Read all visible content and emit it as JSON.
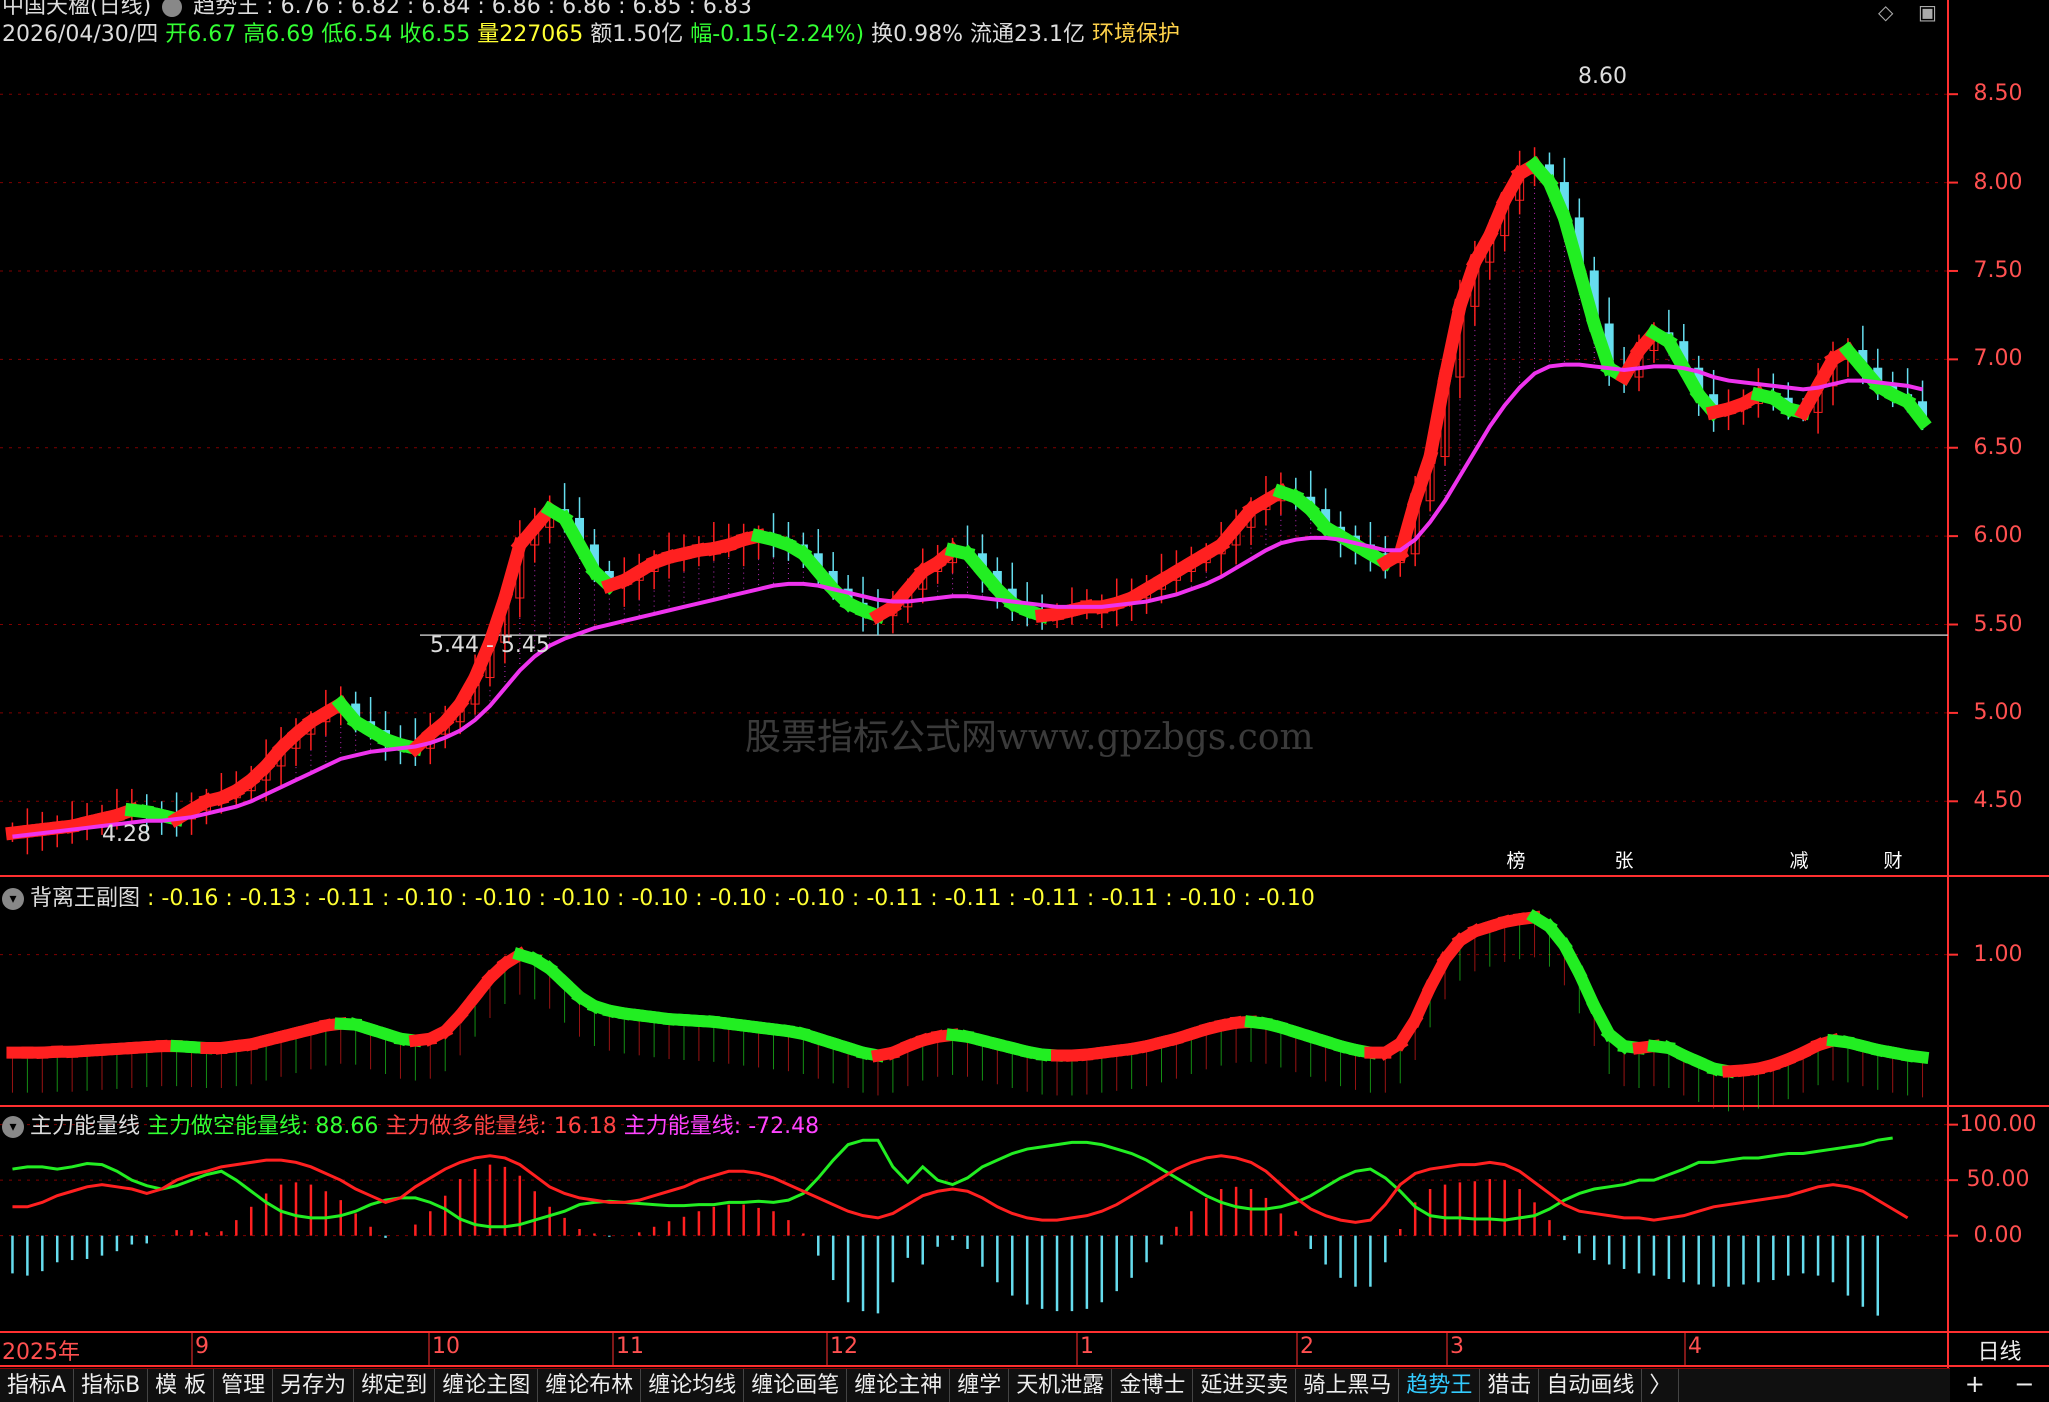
{
  "header": {
    "stock_title": "中国天楹(日线)",
    "indicator_row": "趋势王 : 6.76 : 6.82 : 6.84 : 6.86 : 6.86 : 6.85 : 6.83",
    "date": "2026/04/30/四",
    "open": "开6.67",
    "high": "高6.69",
    "low": "低6.54",
    "close": "收6.55",
    "volume": "量227065",
    "amount": "额1.50亿",
    "change": "幅-0.15(-2.24%)",
    "turnover": "换0.98%",
    "float_cap": "流通23.1亿",
    "tag": "环境保护"
  },
  "price_labels": {
    "high_mark": "8.60",
    "low_mark": "4.28",
    "range_mark": "5.44 - 5.45"
  },
  "panel2": {
    "title": "背离王副图",
    "values": ": -0.16 : -0.13 : -0.11 : -0.10 : -0.10 : -0.10 : -0.10 : -0.10 : -0.10 : -0.11 : -0.11 : -0.11 : -0.11 : -0.10 : -0.10"
  },
  "panel3": {
    "title": "主力能量线",
    "short_line": "主力做空能量线: 88.66",
    "long_line": "主力做多能量线: 16.18",
    "main_line": "主力能量线: -72.48"
  },
  "badges": [
    {
      "text": "榜",
      "color": "#b5651d"
    },
    {
      "text": "张",
      "color": "#b22222"
    },
    {
      "text": "减",
      "color": "#2e8b57"
    },
    {
      "text": "财",
      "color": "#1e4fb0"
    }
  ],
  "watermark": "股票指标公式网www.gpzbgs.com",
  "period_label": "日线",
  "tabs": [
    "指标A",
    "指标B",
    "模 板",
    "管理",
    "另存为",
    "绑定到",
    "缠论主图",
    "缠论布林",
    "缠论均线",
    "缠论画笔",
    "缠论主神",
    "缠学",
    "天机泄露",
    "金博士",
    "延进买卖",
    "骑上黑马",
    "趋势王",
    "猎击",
    "自动画线",
    "〉"
  ],
  "active_tab": "趋势王",
  "right_tools": [
    "+",
    "−"
  ],
  "colors": {
    "up": "#ff2020",
    "down": "#22ee22",
    "ma": "#ee33ee",
    "axis": "#ff3030",
    "grid": "#800000",
    "cyan": "#66ddee"
  },
  "chart_data": [
    {
      "type": "candlestick",
      "title": "中国天楹(日线)",
      "y_ticks": [
        4.5,
        5.0,
        5.5,
        6.0,
        6.5,
        7.0,
        7.5,
        8.0,
        8.5
      ],
      "ylim": [
        4.1,
        8.75
      ],
      "x_ticks": [
        "2025年",
        "9",
        "10",
        "11",
        "12",
        "1",
        "2",
        "3",
        "4"
      ],
      "close": [
        4.32,
        4.33,
        4.34,
        4.35,
        4.36,
        4.38,
        4.4,
        4.42,
        4.45,
        4.44,
        4.42,
        4.4,
        4.45,
        4.5,
        4.52,
        4.56,
        4.62,
        4.7,
        4.8,
        4.88,
        4.95,
        5.0,
        5.05,
        4.95,
        4.9,
        4.85,
        4.82,
        4.8,
        4.88,
        4.95,
        5.05,
        5.2,
        5.4,
        5.65,
        5.95,
        6.05,
        6.15,
        6.1,
        5.95,
        5.8,
        5.72,
        5.75,
        5.8,
        5.85,
        5.88,
        5.9,
        5.92,
        5.93,
        5.95,
        5.98,
        6.0,
        5.98,
        5.95,
        5.9,
        5.8,
        5.7,
        5.62,
        5.58,
        5.55,
        5.6,
        5.7,
        5.8,
        5.85,
        5.92,
        5.9,
        5.8,
        5.7,
        5.62,
        5.58,
        5.55,
        5.56,
        5.58,
        5.6,
        5.6,
        5.62,
        5.65,
        5.7,
        5.75,
        5.8,
        5.85,
        5.9,
        5.95,
        6.05,
        6.15,
        6.2,
        6.25,
        6.22,
        6.15,
        6.05,
        6.0,
        5.95,
        5.9,
        5.85,
        5.9,
        6.2,
        6.45,
        6.9,
        7.3,
        7.55,
        7.7,
        7.9,
        8.05,
        8.1,
        8.0,
        7.8,
        7.5,
        7.2,
        6.95,
        6.9,
        7.05,
        7.15,
        7.1,
        6.95,
        6.8,
        6.7,
        6.72,
        6.75,
        6.8,
        6.78,
        6.72,
        6.7,
        6.85,
        7.0,
        7.05,
        6.95,
        6.85,
        6.8,
        6.76,
        6.65
      ],
      "ma": [
        4.3,
        4.31,
        4.32,
        4.33,
        4.34,
        4.35,
        4.36,
        4.37,
        4.38,
        4.39,
        4.39,
        4.4,
        4.41,
        4.43,
        4.45,
        4.47,
        4.5,
        4.54,
        4.58,
        4.62,
        4.66,
        4.7,
        4.74,
        4.76,
        4.78,
        4.79,
        4.8,
        4.81,
        4.83,
        4.86,
        4.9,
        4.96,
        5.04,
        5.14,
        5.24,
        5.32,
        5.38,
        5.42,
        5.45,
        5.48,
        5.5,
        5.52,
        5.54,
        5.56,
        5.58,
        5.6,
        5.62,
        5.64,
        5.66,
        5.68,
        5.7,
        5.72,
        5.73,
        5.73,
        5.72,
        5.7,
        5.68,
        5.66,
        5.64,
        5.63,
        5.63,
        5.64,
        5.65,
        5.66,
        5.66,
        5.65,
        5.64,
        5.63,
        5.62,
        5.61,
        5.6,
        5.6,
        5.6,
        5.6,
        5.61,
        5.62,
        5.63,
        5.65,
        5.67,
        5.7,
        5.73,
        5.77,
        5.82,
        5.87,
        5.92,
        5.96,
        5.98,
        5.99,
        5.99,
        5.98,
        5.96,
        5.94,
        5.92,
        5.92,
        5.98,
        6.08,
        6.2,
        6.34,
        6.48,
        6.62,
        6.74,
        6.84,
        6.92,
        6.96,
        6.97,
        6.97,
        6.96,
        6.95,
        6.94,
        6.95,
        6.96,
        6.96,
        6.95,
        6.93,
        6.9,
        6.88,
        6.87,
        6.86,
        6.85,
        6.84,
        6.83,
        6.84,
        6.86,
        6.88,
        6.88,
        6.87,
        6.86,
        6.85,
        6.83
      ]
    },
    {
      "type": "line",
      "title": "背离王副图",
      "y_ticks": [
        1.0
      ],
      "ylim": [
        -0.6,
        1.8
      ],
      "values": [
        -0.05,
        -0.05,
        -0.05,
        -0.04,
        -0.04,
        -0.03,
        -0.02,
        -0.01,
        0.0,
        0.01,
        0.02,
        0.02,
        0.01,
        0.0,
        0.0,
        0.02,
        0.04,
        0.08,
        0.12,
        0.16,
        0.2,
        0.24,
        0.26,
        0.25,
        0.2,
        0.15,
        0.1,
        0.08,
        0.1,
        0.18,
        0.35,
        0.55,
        0.75,
        0.9,
        1.0,
        0.95,
        0.85,
        0.7,
        0.55,
        0.45,
        0.4,
        0.37,
        0.35,
        0.33,
        0.31,
        0.3,
        0.29,
        0.28,
        0.26,
        0.24,
        0.22,
        0.2,
        0.18,
        0.15,
        0.1,
        0.05,
        0.0,
        -0.05,
        -0.08,
        -0.05,
        0.02,
        0.08,
        0.12,
        0.14,
        0.12,
        0.08,
        0.04,
        0.0,
        -0.04,
        -0.07,
        -0.08,
        -0.08,
        -0.07,
        -0.05,
        -0.03,
        -0.01,
        0.02,
        0.06,
        0.1,
        0.15,
        0.2,
        0.24,
        0.27,
        0.28,
        0.26,
        0.22,
        0.17,
        0.12,
        0.07,
        0.02,
        -0.02,
        -0.05,
        -0.05,
        0.05,
        0.3,
        0.65,
        0.95,
        1.15,
        1.25,
        1.3,
        1.35,
        1.38,
        1.4,
        1.3,
        1.1,
        0.8,
        0.45,
        0.15,
        0.02,
        0.0,
        0.02,
        0.0,
        -0.08,
        -0.15,
        -0.22,
        -0.25,
        -0.24,
        -0.22,
        -0.18,
        -0.12,
        -0.05,
        0.03,
        0.08,
        0.06,
        0.02,
        -0.02,
        -0.05,
        -0.08,
        -0.1
      ]
    },
    {
      "type": "line",
      "title": "主力能量线",
      "y_ticks": [
        0.0,
        50.0,
        100.0
      ],
      "ylim": [
        -85,
        115
      ],
      "series": [
        {
          "name": "主力做空能量线",
          "color": "#22ee22",
          "values": [
            60,
            62,
            62,
            60,
            62,
            65,
            64,
            58,
            50,
            45,
            42,
            45,
            50,
            55,
            58,
            50,
            40,
            30,
            22,
            18,
            16,
            16,
            18,
            22,
            28,
            32,
            34,
            34,
            30,
            24,
            15,
            10,
            8,
            8,
            10,
            14,
            18,
            22,
            28,
            30,
            31,
            30,
            29,
            28,
            27,
            27,
            28,
            28,
            30,
            30,
            31,
            30,
            32,
            38,
            52,
            68,
            82,
            86,
            86,
            62,
            48,
            62,
            50,
            46,
            52,
            62,
            68,
            74,
            78,
            80,
            82,
            84,
            84,
            82,
            78,
            74,
            68,
            60,
            52,
            44,
            36,
            30,
            26,
            24,
            24,
            26,
            30,
            36,
            44,
            52,
            58,
            60,
            52,
            40,
            26,
            18,
            16,
            16,
            15,
            15,
            14,
            16,
            18,
            24,
            32,
            38,
            42,
            44,
            46,
            50,
            50,
            55,
            60,
            66,
            66,
            68,
            70,
            70,
            72,
            74,
            74,
            76,
            78,
            80,
            82,
            86,
            88
          ]
        },
        {
          "name": "主力做多能量线",
          "color": "#ff2020",
          "values": [
            26,
            26,
            30,
            36,
            40,
            44,
            46,
            44,
            42,
            38,
            42,
            50,
            55,
            58,
            62,
            64,
            66,
            68,
            68,
            66,
            62,
            56,
            50,
            42,
            36,
            30,
            34,
            44,
            52,
            60,
            66,
            70,
            72,
            70,
            64,
            54,
            44,
            38,
            34,
            32,
            30,
            30,
            32,
            36,
            40,
            44,
            50,
            54,
            58,
            58,
            56,
            52,
            46,
            40,
            34,
            28,
            22,
            18,
            16,
            20,
            28,
            36,
            40,
            42,
            40,
            34,
            26,
            20,
            16,
            14,
            14,
            16,
            18,
            22,
            28,
            36,
            44,
            52,
            60,
            66,
            70,
            72,
            70,
            66,
            58,
            46,
            34,
            24,
            18,
            14,
            12,
            14,
            28,
            46,
            56,
            60,
            62,
            64,
            64,
            66,
            64,
            58,
            48,
            38,
            28,
            22,
            20,
            18,
            16,
            16,
            14,
            16,
            18,
            22,
            26,
            28,
            30,
            32,
            34,
            36,
            40,
            44,
            46,
            44,
            40,
            32,
            24,
            16
          ]
        },
        {
          "name": "主力能量线",
          "color": "#66ddee",
          "values": [
            -34,
            -36,
            -32,
            -24,
            -22,
            -21,
            -18,
            -14,
            -8,
            -7,
            0,
            5,
            5,
            3,
            4,
            14,
            26,
            38,
            46,
            48,
            46,
            40,
            32,
            20,
            8,
            -2,
            0,
            10,
            22,
            36,
            51,
            60,
            64,
            62,
            54,
            40,
            26,
            16,
            6,
            2,
            -1,
            0,
            3,
            8,
            13,
            17,
            22,
            26,
            28,
            28,
            25,
            22,
            14,
            2,
            -18,
            -40,
            -60,
            -68,
            -70,
            -42,
            -20,
            -26,
            -10,
            -4,
            -12,
            -28,
            -42,
            -54,
            -62,
            -66,
            -68,
            -68,
            -66,
            -60,
            -50,
            -38,
            -24,
            -8,
            8,
            22,
            34,
            42,
            44,
            42,
            34,
            20,
            4,
            -12,
            -26,
            -38,
            -46,
            -46,
            -24,
            6,
            30,
            42,
            46,
            48,
            49,
            51,
            50,
            42,
            30,
            14,
            -4,
            -16,
            -22,
            -26,
            -30,
            -34,
            -36,
            -39,
            -42,
            -44,
            -46,
            -46,
            -44,
            -42,
            -40,
            -36,
            -34,
            -36,
            -42,
            -54,
            -64,
            -72
          ]
        }
      ]
    }
  ]
}
